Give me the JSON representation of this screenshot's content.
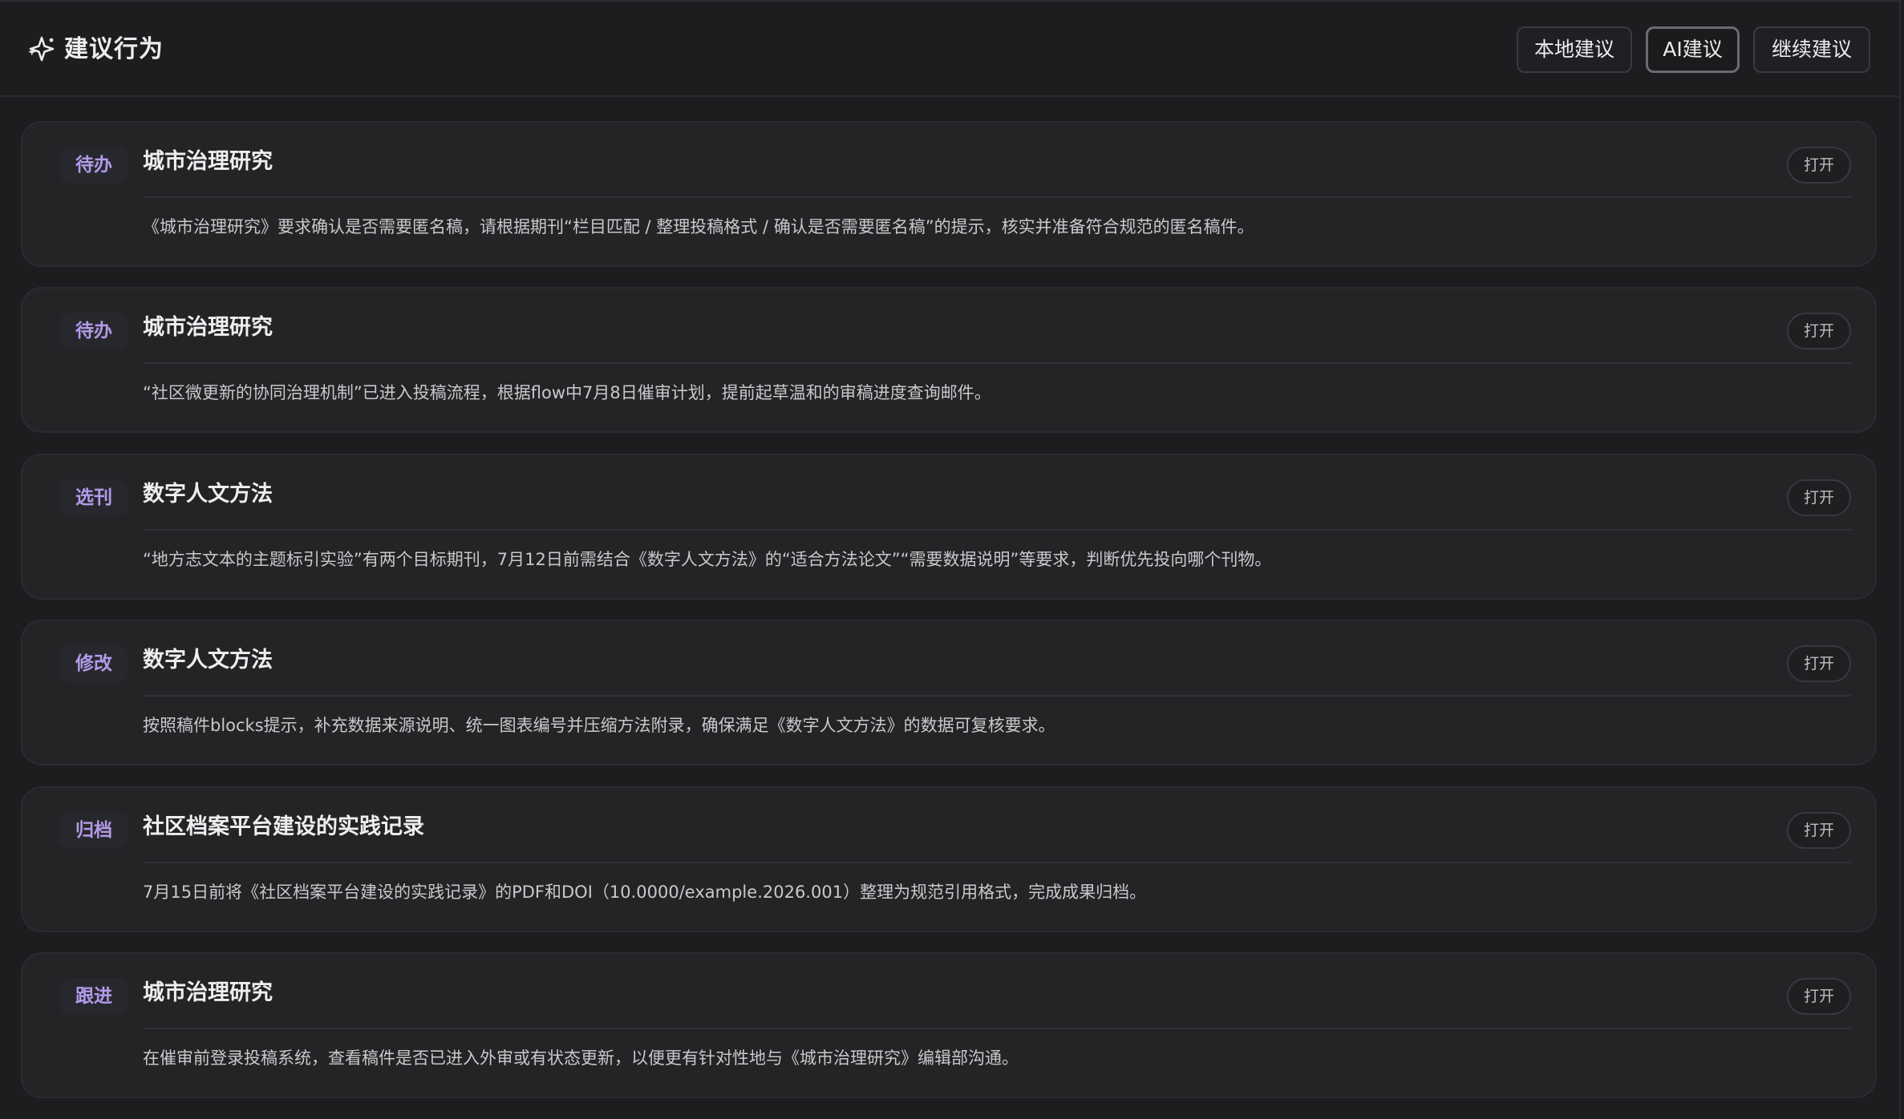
{
  "header": {
    "icon": "sparkles-icon",
    "title": "建议行为",
    "tabs": [
      {
        "label": "本地建议",
        "active": false
      },
      {
        "label": "AI建议",
        "active": true
      },
      {
        "label": "继续建议",
        "active": false
      }
    ]
  },
  "suggestions": [
    {
      "tag": "待办",
      "title": "城市治理研究",
      "open_label": "打开",
      "description": "《城市治理研究》要求确认是否需要匿名稿，请根据期刊“栏目匹配 / 整理投稿格式 / 确认是否需要匿名稿”的提示，核实并准备符合规范的匿名稿件。"
    },
    {
      "tag": "待办",
      "title": "城市治理研究",
      "open_label": "打开",
      "description": "“社区微更新的协同治理机制”已进入投稿流程，根据flow中7月8日催审计划，提前起草温和的审稿进度查询邮件。"
    },
    {
      "tag": "选刊",
      "title": "数字人文方法",
      "open_label": "打开",
      "description": "“地方志文本的主题标引实验”有两个目标期刊，7月12日前需结合《数字人文方法》的“适合方法论文”“需要数据说明”等要求，判断优先投向哪个刊物。"
    },
    {
      "tag": "修改",
      "title": "数字人文方法",
      "open_label": "打开",
      "description": "按照稿件blocks提示，补充数据来源说明、统一图表编号并压缩方法附录，确保满足《数字人文方法》的数据可复核要求。"
    },
    {
      "tag": "归档",
      "title": "社区档案平台建设的实践记录",
      "open_label": "打开",
      "description": "7月15日前将《社区档案平台建设的实践记录》的PDF和DOI（10.0000/example.2026.001）整理为规范引用格式，完成成果归档。"
    },
    {
      "tag": "跟进",
      "title": "城市治理研究",
      "open_label": "打开",
      "description": "在催审前登录投稿系统，查看稿件是否已进入外审或有状态更新，以便更有针对性地与《城市治理研究》编辑部沟通。"
    }
  ],
  "colors": {
    "background": "#1c1d1f",
    "card": "#232426",
    "tag_text": "#b39ae8"
  }
}
